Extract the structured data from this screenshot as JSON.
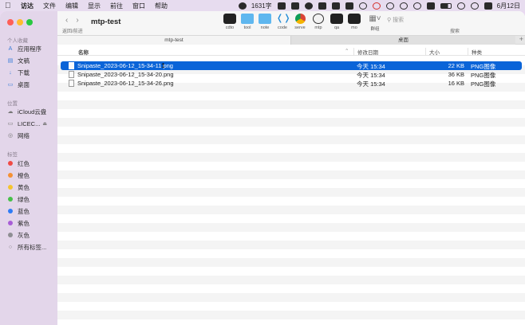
{
  "menubar": {
    "app_name": "访达",
    "items": [
      "文件",
      "编辑",
      "显示",
      "前往",
      "窗口",
      "帮助"
    ],
    "word_count": "1631字",
    "date": "6月12日"
  },
  "sidebar": {
    "favorites_title": "个人收藏",
    "favorites": [
      {
        "label": "应用程序",
        "icon": "applications-icon"
      },
      {
        "label": "文稿",
        "icon": "document-icon"
      },
      {
        "label": "下载",
        "icon": "download-icon"
      },
      {
        "label": "桌面",
        "icon": "desktop-icon"
      }
    ],
    "locations_title": "位置",
    "locations": [
      {
        "label": "iCloud云盘",
        "icon": "cloud-icon"
      },
      {
        "label": "LICEC...",
        "icon": "drive-icon"
      },
      {
        "label": "网络",
        "icon": "network-icon"
      }
    ],
    "tags_title": "标签",
    "tags": [
      {
        "label": "红色",
        "color": "#f04a45"
      },
      {
        "label": "橙色",
        "color": "#f59134"
      },
      {
        "label": "黄色",
        "color": "#f5c42f"
      },
      {
        "label": "绿色",
        "color": "#47c04a"
      },
      {
        "label": "蓝色",
        "color": "#2f7cf6"
      },
      {
        "label": "紫色",
        "color": "#a85dd6"
      },
      {
        "label": "灰色",
        "color": "#8e8e93"
      },
      {
        "label": "所有标签...",
        "color": ""
      }
    ]
  },
  "toolbar": {
    "back_forward_label": "返回/前进",
    "title": "mtp-test",
    "tools": [
      {
        "label": "cdto",
        "icon": "terminal-icon"
      },
      {
        "label": "tool",
        "icon": "folder-icon"
      },
      {
        "label": "note",
        "icon": "folder-icon"
      },
      {
        "label": "code",
        "icon": "vscode-icon"
      },
      {
        "label": "serve",
        "icon": "chrome-icon"
      },
      {
        "label": "mtp",
        "icon": "panda-icon"
      },
      {
        "label": "qa",
        "icon": "app-icon"
      },
      {
        "label": "mo",
        "icon": "app-icon"
      },
      {
        "label": "群组",
        "icon": "group-grid-icon"
      }
    ],
    "search_placeholder": "搜索",
    "search_caption": "搜索"
  },
  "tabs": [
    "mtp-test",
    "桌面"
  ],
  "columns": {
    "name": "名称",
    "date": "修改日期",
    "size": "大小",
    "kind": "种类"
  },
  "files": [
    {
      "name": "Snipaste_2023-06-12_15-34-11.png",
      "date": "今天 15:34",
      "size": "22 KB",
      "kind": "PNG图像",
      "selected": true
    },
    {
      "name": "Snipaste_2023-06-12_15-34-20.png",
      "date": "今天 15:34",
      "size": "36 KB",
      "kind": "PNG图像",
      "selected": false
    },
    {
      "name": "Snipaste_2023-06-12_15-34-26.png",
      "date": "今天 15:34",
      "size": "16 KB",
      "kind": "PNG图像",
      "selected": false
    }
  ]
}
